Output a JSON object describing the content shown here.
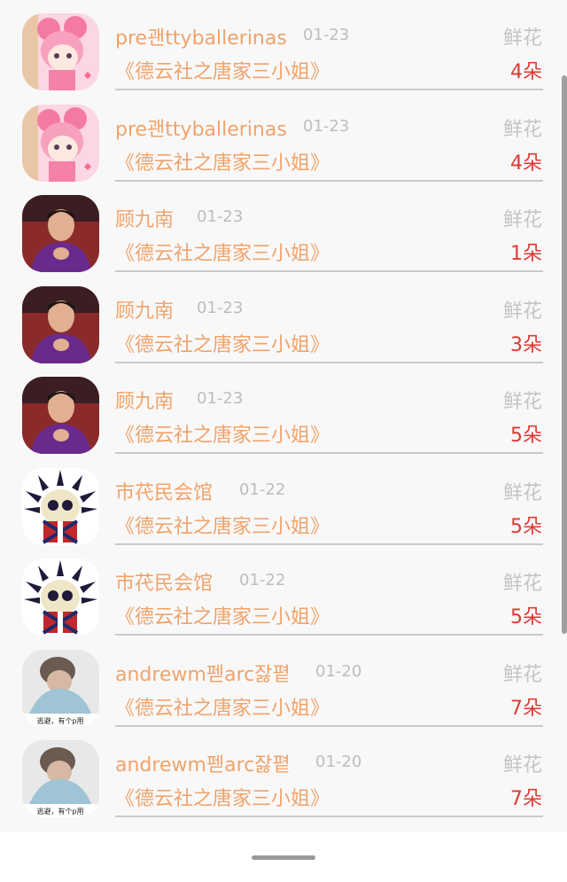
{
  "rows": [
    {
      "user": "pre괜ttyballerinas",
      "date": "01-23",
      "gift_label": "鲜花",
      "title": "《德云社之唐家三小姐》",
      "count": "4朵",
      "avatar": "pink-anime-girl-avatar"
    },
    {
      "user": "pre괜ttyballerinas",
      "date": "01-23",
      "gift_label": "鲜花",
      "title": "《德云社之唐家三小姐》",
      "count": "4朵",
      "avatar": "pink-anime-girl-avatar"
    },
    {
      "user": "顾九南",
      "date": "01-23",
      "gift_label": "鲜花",
      "title": "《德云社之唐家三小姐》",
      "count": "1朵",
      "avatar": "man-purple-robe-avatar"
    },
    {
      "user": "顾九南",
      "date": "01-23",
      "gift_label": "鲜花",
      "title": "《德云社之唐家三小姐》",
      "count": "3朵",
      "avatar": "man-purple-robe-avatar"
    },
    {
      "user": "顾九南",
      "date": "01-23",
      "gift_label": "鲜花",
      "title": "《德云社之唐家三小姐》",
      "count": "5朵",
      "avatar": "man-purple-robe-avatar"
    },
    {
      "user": "市䒫民会馆",
      "date": "01-22",
      "gift_label": "鲜花",
      "title": "《德云社之唐家三小姐》",
      "count": "5朵",
      "avatar": "spiky-skull-avatar"
    },
    {
      "user": "市䒫民会馆",
      "date": "01-22",
      "gift_label": "鲜花",
      "title": "《德云社之唐家三小姐》",
      "count": "5朵",
      "avatar": "spiky-skull-avatar"
    },
    {
      "user": "andrewm펟arc잟폍",
      "date": "01-20",
      "gift_label": "鲜花",
      "title": "《德云社之唐家三小姐》",
      "count": "7朵",
      "avatar": "child-photo-avatar",
      "avatar_caption": "逃避，有个p用"
    },
    {
      "user": "andrewm펟arc잟폍",
      "date": "01-20",
      "gift_label": "鲜花",
      "title": "《德云社之唐家三小姐》",
      "count": "7朵",
      "avatar": "child-photo-avatar",
      "avatar_caption": "逃避，有个p用"
    }
  ],
  "colors": {
    "name": "#f0a36a",
    "date": "#bdbdbd",
    "gift_label": "#c4c4c4",
    "count": "#dc3a32",
    "divider": "#c9c9c9"
  }
}
